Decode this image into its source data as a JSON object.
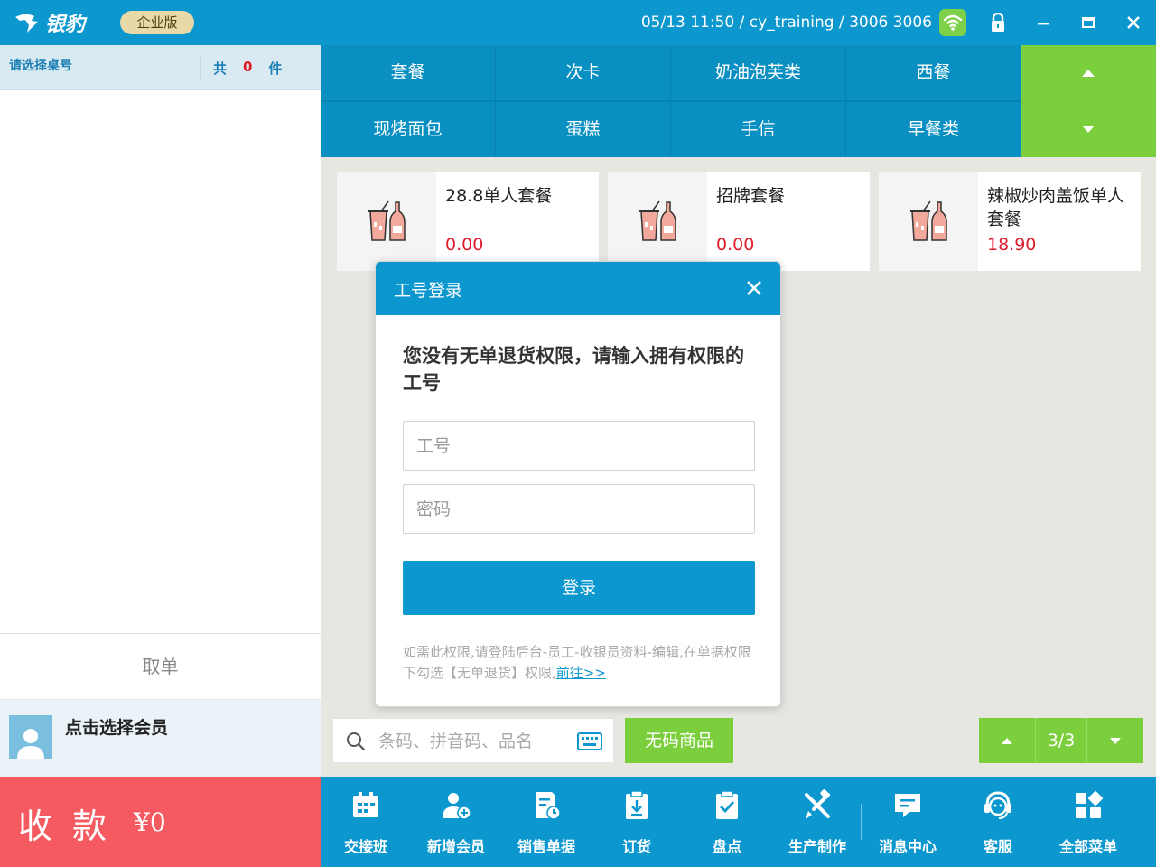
{
  "topbar": {
    "logo_text": "银豹",
    "edition": "企业版",
    "session": "05/13 11:50 / cy_training / 3006 3006"
  },
  "left_panel": {
    "table_select": "请选择桌号",
    "count_prefix": "共",
    "count_value": "0",
    "count_suffix": "件",
    "cancel_label": "取单",
    "member_label": "点击选择会员",
    "pay_label": "收款",
    "pay_amount": "¥0"
  },
  "categories": {
    "row1": [
      "套餐",
      "次卡",
      "奶油泡芙类",
      "西餐"
    ],
    "row2": [
      "现烤面包",
      "蛋糕",
      "手信",
      "早餐类"
    ]
  },
  "products": [
    {
      "name": "28.8单人套餐",
      "price": "0.00"
    },
    {
      "name": "招牌套餐",
      "price": "0.00"
    },
    {
      "name": "辣椒炒肉盖饭单人套餐",
      "price": "18.90"
    }
  ],
  "search": {
    "placeholder": "条码、拼音码、品名"
  },
  "nocode_label": "无码商品",
  "pager": {
    "text": "3/3"
  },
  "toolbar": {
    "items": [
      "交接班",
      "新增会员",
      "销售单据",
      "订货",
      "盘点",
      "生产制作",
      "消息中心",
      "客服",
      "全部菜单"
    ]
  },
  "modal": {
    "title": "工号登录",
    "message": "您没有无单退货权限，请输入拥有权限的工号",
    "id_placeholder": "工号",
    "password_placeholder": "密码",
    "login_label": "登录",
    "hint_text": "如需此权限,请登陆后台-员工-收银员资料-编辑,在单据权限下勾选【无单退货】权限,",
    "hint_link": "前往>>"
  },
  "colors": {
    "primary": "#0c98cf",
    "accent_green": "#7ccf3c",
    "pay_red": "#f45a5f",
    "price_red": "#e01c2c"
  }
}
